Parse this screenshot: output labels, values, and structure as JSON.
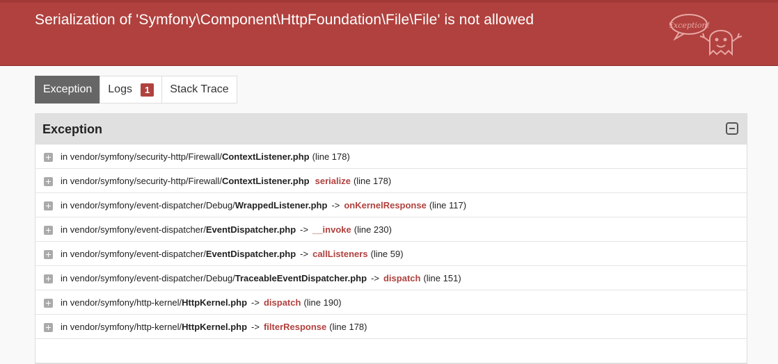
{
  "header": {
    "title": "Serialization of 'Symfony\\Component\\HttpFoundation\\File\\File' is not allowed",
    "logo_text": "Exception!"
  },
  "tabs": [
    {
      "label": "Exception",
      "active": true
    },
    {
      "label": "Logs",
      "badge": "1",
      "active": false
    },
    {
      "label": "Stack Trace",
      "active": false
    }
  ],
  "panel": {
    "title": "Exception",
    "toggle_icon": "minus-square-icon"
  },
  "trace": [
    {
      "prefix": "in",
      "path": "vendor/symfony/security-http/Firewall/",
      "file": "ContextListener.php",
      "arrow": "",
      "method": "",
      "line": "(line 178)"
    },
    {
      "prefix": "in",
      "path": "vendor/symfony/security-http/Firewall/",
      "file": "ContextListener.php",
      "arrow": "",
      "method": "serialize",
      "line": "(line 178)"
    },
    {
      "prefix": "in",
      "path": "vendor/symfony/event-dispatcher/Debug/",
      "file": "WrappedListener.php",
      "arrow": "->",
      "method": "onKernelResponse",
      "line": "(line 117)"
    },
    {
      "prefix": "in",
      "path": "vendor/symfony/event-dispatcher/",
      "file": "EventDispatcher.php",
      "arrow": "->",
      "method": "__invoke",
      "line": "(line 230)"
    },
    {
      "prefix": "in",
      "path": "vendor/symfony/event-dispatcher/",
      "file": "EventDispatcher.php",
      "arrow": "->",
      "method": "callListeners",
      "line": "(line 59)"
    },
    {
      "prefix": "in",
      "path": "vendor/symfony/event-dispatcher/Debug/",
      "file": "TraceableEventDispatcher.php",
      "arrow": "->",
      "method": "dispatch",
      "line": "(line 151)"
    },
    {
      "prefix": "in",
      "path": "vendor/symfony/http-kernel/",
      "file": "HttpKernel.php",
      "arrow": "->",
      "method": "dispatch",
      "line": "(line 190)"
    },
    {
      "prefix": "in",
      "path": "vendor/symfony/http-kernel/",
      "file": "HttpKernel.php",
      "arrow": "->",
      "method": "filterResponse",
      "line": "(line 178)"
    },
    {
      "prefix": "",
      "path": "",
      "file": "",
      "arrow": "",
      "method": "",
      "line": ""
    }
  ],
  "colors": {
    "header_bg": "#b0413e",
    "accent": "#b0413e",
    "active_tab": "#666666"
  }
}
